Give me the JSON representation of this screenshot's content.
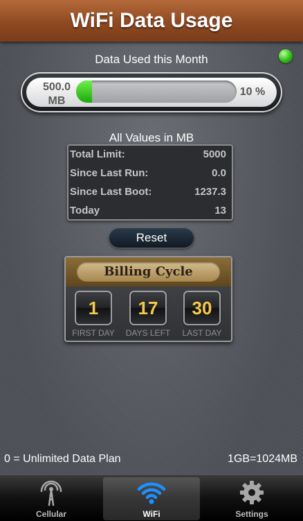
{
  "title": "WiFi Data Usage",
  "usage": {
    "heading": "Data Used this Month",
    "used_value": "500.0",
    "used_unit": "MB",
    "percent_label": "10 %",
    "percent_fraction": 0.1,
    "status_color": "#2fbf16"
  },
  "stats": {
    "heading": "All Values in MB",
    "rows": [
      {
        "label": "Total Limit:",
        "value": "5000"
      },
      {
        "label": "Since Last Run:",
        "value": "0.0"
      },
      {
        "label": "Since Last Boot:",
        "value": "1237.3"
      },
      {
        "label": "Today",
        "value": "13"
      }
    ]
  },
  "reset_label": "Reset",
  "billing": {
    "title": "Billing Cycle",
    "items": [
      {
        "value": "1",
        "caption": "FIRST DAY"
      },
      {
        "value": "17",
        "caption": "DAYS LEFT"
      },
      {
        "value": "30",
        "caption": "LAST DAY"
      }
    ]
  },
  "footer": {
    "left": "0 = Unlimited Data Plan",
    "right": "1GB=1024MB"
  },
  "tabs": [
    {
      "label": "Cellular",
      "icon": "cellular-tower-icon",
      "active": false
    },
    {
      "label": "WiFi",
      "icon": "wifi-icon",
      "active": true
    },
    {
      "label": "Settings",
      "icon": "gear-icon",
      "active": false
    }
  ],
  "colors": {
    "title_bar": "#8e4a22",
    "accent_digits": "#f6c94a",
    "progress_fill": "#1aa80a",
    "active_tab_icon": "#1e90ff"
  }
}
